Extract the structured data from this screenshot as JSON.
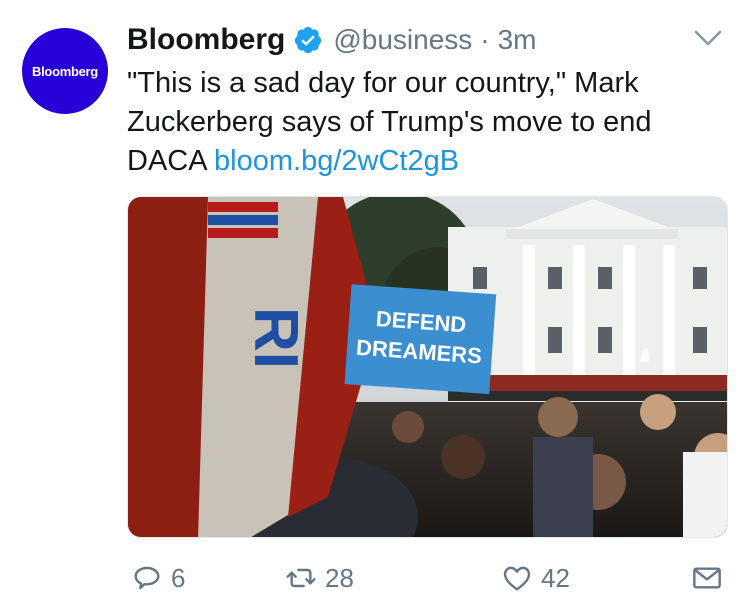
{
  "tweet": {
    "avatar_text": "Bloomberg",
    "author_name": "Bloomberg",
    "handle": "@business",
    "separator": "·",
    "time": "3m",
    "text": "\"This is a sad day for our country,\" Mark Zuckerberg says of Trump's move to end DACA",
    "link": "bloom.bg/2wCt2gB",
    "media": {
      "sign_line1": "DEFEND",
      "sign_line2": "DREAMERS",
      "banner_text": "RI"
    },
    "actions": {
      "replies": "6",
      "retweets": "28",
      "likes": "42"
    }
  },
  "colors": {
    "avatar_bg": "#2800d7",
    "link": "#1b95e0",
    "muted": "#657786",
    "verified": "#1da1f2"
  },
  "icons": [
    "verified-badge-icon",
    "chevron-down-icon",
    "reply-icon",
    "retweet-icon",
    "like-icon",
    "direct-message-icon"
  ]
}
